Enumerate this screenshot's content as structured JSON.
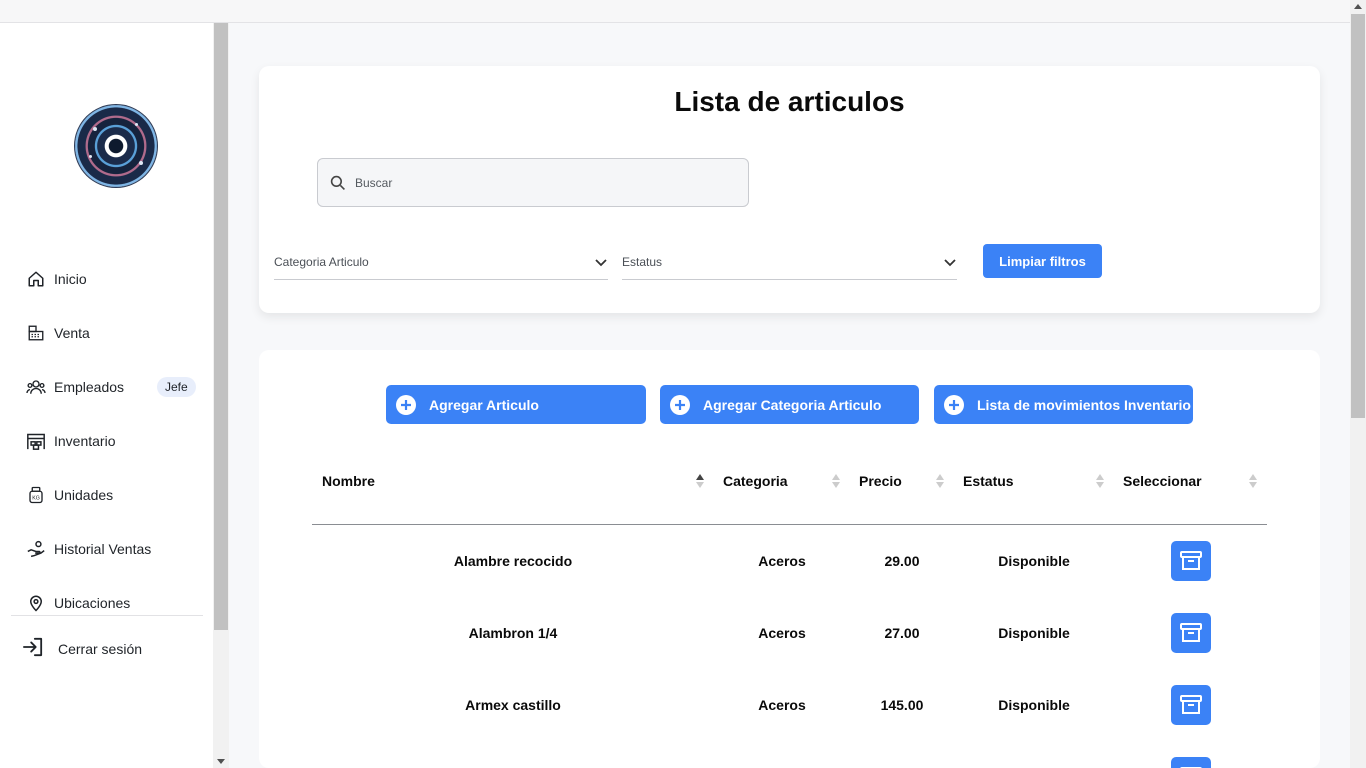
{
  "sidebar": {
    "items": [
      {
        "label": "Inicio",
        "icon": "home-icon"
      },
      {
        "label": "Venta",
        "icon": "cash-register-icon"
      },
      {
        "label": "Empleados",
        "icon": "users-icon",
        "badge": "Jefe"
      },
      {
        "label": "Inventario",
        "icon": "warehouse-icon"
      },
      {
        "label": "Unidades",
        "icon": "weight-icon"
      },
      {
        "label": "Historial Ventas",
        "icon": "hand-coin-icon"
      },
      {
        "label": "Ubicaciones",
        "icon": "map-pin-icon"
      }
    ],
    "logout_label": "Cerrar sesión"
  },
  "filters": {
    "title": "Lista de articulos",
    "search_placeholder": "Buscar",
    "category_select": "Categoria Articulo",
    "status_select": "Estatus",
    "clear_label": "Limpiar filtros"
  },
  "actions": {
    "add_article": "Agregar Articulo",
    "add_category": "Agregar Categoria Articulo",
    "movements": "Lista de movimientos Inventario"
  },
  "table": {
    "columns": [
      "Nombre",
      "Categoria",
      "Precio",
      "Estatus",
      "Seleccionar"
    ],
    "rows": [
      {
        "nombre": "Alambre recocido",
        "categoria": "Aceros",
        "precio": "29.00",
        "estatus": "Disponible"
      },
      {
        "nombre": "Alambron 1/4",
        "categoria": "Aceros",
        "precio": "27.00",
        "estatus": "Disponible"
      },
      {
        "nombre": "Armex castillo",
        "categoria": "Aceros",
        "precio": "145.00",
        "estatus": "Disponible"
      }
    ]
  },
  "colors": {
    "accent": "#3b82f6",
    "background": "#f7f8fa",
    "badge_bg": "#e8eefb"
  }
}
